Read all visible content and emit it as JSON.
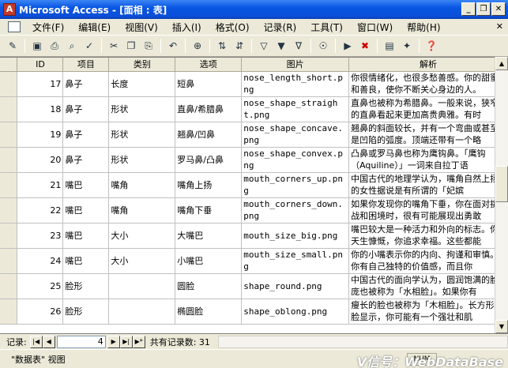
{
  "window": {
    "title": "Microsoft Access - [面相 : 表]",
    "app_icon": "A",
    "buttons": {
      "minimize": "_",
      "restore": "❐",
      "close": "✕"
    }
  },
  "menu": {
    "items": [
      "文件(F)",
      "编辑(E)",
      "视图(V)",
      "插入(I)",
      "格式(O)",
      "记录(R)",
      "工具(T)",
      "窗口(W)",
      "帮助(H)"
    ],
    "doc_close": "✕"
  },
  "toolbar": {
    "icons": [
      "design-view-icon",
      "save-icon",
      "print-icon",
      "print-preview-icon",
      "spelling-icon",
      "cut-icon",
      "copy-icon",
      "paste-icon",
      "undo-icon",
      "hyperlink-icon",
      "sort-ascending-icon",
      "sort-descending-icon",
      "filter-by-selection-icon",
      "filter-by-form-icon",
      "apply-filter-icon",
      "find-icon",
      "new-record-icon",
      "delete-record-icon",
      "database-window-icon",
      "new-object-icon",
      "help-icon"
    ]
  },
  "grid": {
    "columns": [
      "ID",
      "项目",
      "类别",
      "选项",
      "图片",
      "解析"
    ],
    "rows": [
      {
        "id": "17",
        "item": "鼻子",
        "category": "长度",
        "option": "短鼻",
        "image": "nose_length_short.png",
        "analysis": "你很情绪化，也很多愁善感。你的甜蜜和善良，使你不断关心身边的人。"
      },
      {
        "id": "18",
        "item": "鼻子",
        "category": "形状",
        "option": "直鼻/希腊鼻",
        "image": "nose_shape_straight.png",
        "analysis": "直鼻也被称为希腊鼻。一般来说，狭窄的直鼻看起来更加高贵典雅。有时"
      },
      {
        "id": "19",
        "item": "鼻子",
        "category": "形状",
        "option": "翘鼻/凹鼻",
        "image": "nose_shape_concave.png",
        "analysis": "翘鼻的斜面较长，并有一个弯曲或甚至是凹陷的弧度。顶端还带有一个略"
      },
      {
        "id": "20",
        "item": "鼻子",
        "category": "形状",
        "option": "罗马鼻/凸鼻",
        "image": "nose_shape_convex.png",
        "analysis": "凸鼻或罗马鼻也称为鹰钩鼻。「鹰钩（Aquiline）」一词来自拉丁语"
      },
      {
        "id": "21",
        "item": "嘴巴",
        "category": "嘴角",
        "option": "嘴角上扬",
        "image": "mouth_corners_up.png",
        "analysis": "中国古代的地理学认为，嘴角自然上扬的女性据说是有所谓的「妃嫔"
      },
      {
        "id": "22",
        "item": "嘴巴",
        "category": "嘴角",
        "option": "嘴角下垂",
        "image": "mouth_corners_down.png",
        "analysis": "如果你发现你的嘴角下垂，你在面对挑战和困境时，很有可能展现出勇敢"
      },
      {
        "id": "23",
        "item": "嘴巴",
        "category": "大小",
        "option": "大嘴巴",
        "image": "mouth_size_big.png",
        "analysis": "嘴巴较大是一种活力和外向的标志。你天生慷慨，你追求幸福。这些都能"
      },
      {
        "id": "24",
        "item": "嘴巴",
        "category": "大小",
        "option": "小嘴巴",
        "image": "mouth_size_small.png",
        "analysis": "你的小嘴表示你的内向、拘谨和审慎。你有自己独特的价值感，而且你"
      },
      {
        "id": "25",
        "item": "脸形",
        "category": "",
        "option": "圆脸",
        "image": "shape_round.png",
        "analysis": "中国古代的面向学认为，圆润饱满的脸庞也被称为「水相脸」。如果你有"
      },
      {
        "id": "26",
        "item": "脸形",
        "category": "",
        "option": "椭圆脸",
        "image": "shape_oblong.png",
        "analysis": "瘦长的脸也被称为「木相脸」。长方形的脸显示，你可能有一个强壮和肌"
      }
    ]
  },
  "navigation": {
    "label": "记录:",
    "current": "4",
    "count_text": "共有记录数: 31",
    "btn_first": "|◀",
    "btn_prev": "◀",
    "btn_next": "▶",
    "btn_last": "▶|",
    "btn_new": "▶*"
  },
  "status": {
    "view": "\"数据表\" 视图",
    "indicator": "NUM",
    "watermark": "V信号：WebDataBase"
  }
}
